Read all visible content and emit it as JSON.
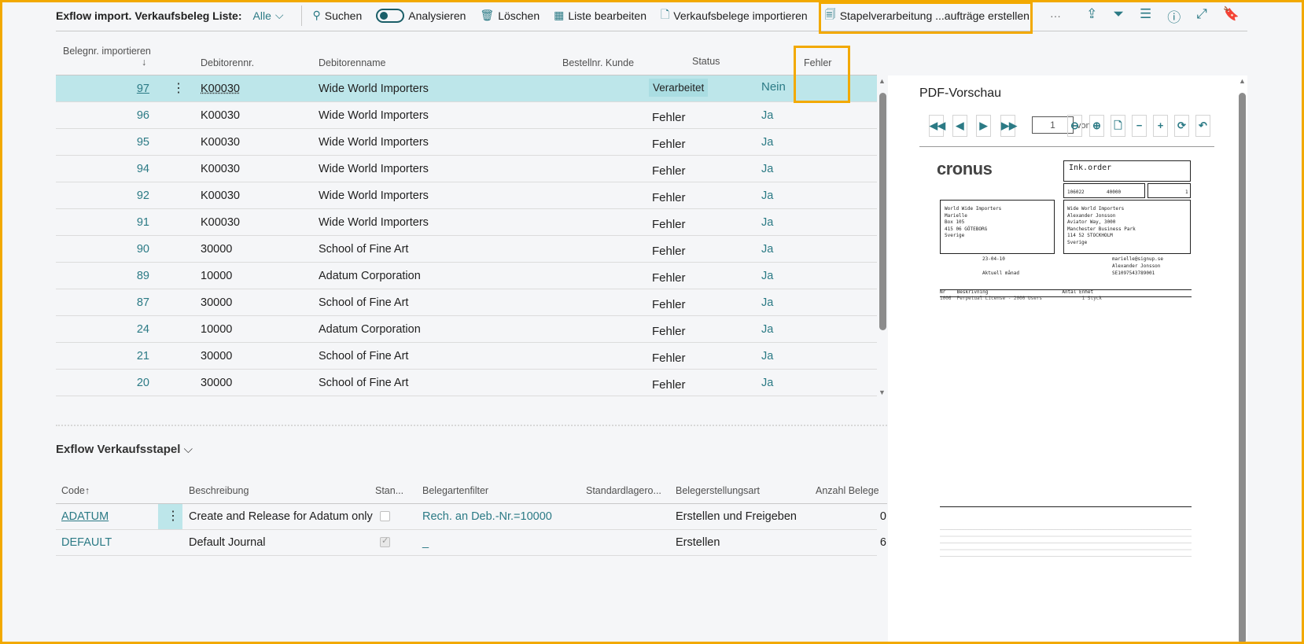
{
  "toolbar": {
    "title": "Exflow import. Verkaufsbeleg Liste:",
    "filter": "Alle",
    "search": "Suchen",
    "analyze": "Analysieren",
    "delete": "Löschen",
    "edit_list": "Liste bearbeiten",
    "import": "Verkaufsbelege importieren",
    "batch": "Stapelverarbeitung ...aufträge erstellen",
    "more": "···"
  },
  "table": {
    "columns": [
      "Belegnr. importieren",
      "Debitorennr.",
      "Debitorenname",
      "Bestellnr. Kunde",
      "Status",
      "Fehler"
    ],
    "sort_icon": "↓",
    "rows": [
      {
        "no": "97",
        "cust": "K00030",
        "name": "Wide World Importers",
        "order": "",
        "status": "Verarbeitet",
        "error": "Nein"
      },
      {
        "no": "96",
        "cust": "K00030",
        "name": "Wide World Importers",
        "order": "",
        "status": "Fehler",
        "error": "Ja"
      },
      {
        "no": "95",
        "cust": "K00030",
        "name": "Wide World Importers",
        "order": "",
        "status": "Fehler",
        "error": "Ja"
      },
      {
        "no": "94",
        "cust": "K00030",
        "name": "Wide World Importers",
        "order": "",
        "status": "Fehler",
        "error": "Ja"
      },
      {
        "no": "92",
        "cust": "K00030",
        "name": "Wide World Importers",
        "order": "",
        "status": "Fehler",
        "error": "Ja"
      },
      {
        "no": "91",
        "cust": "K00030",
        "name": "Wide World Importers",
        "order": "",
        "status": "Fehler",
        "error": "Ja"
      },
      {
        "no": "90",
        "cust": "30000",
        "name": "School of Fine Art",
        "order": "",
        "status": "Fehler",
        "error": "Ja"
      },
      {
        "no": "89",
        "cust": "10000",
        "name": "Adatum Corporation",
        "order": "",
        "status": "Fehler",
        "error": "Ja"
      },
      {
        "no": "87",
        "cust": "30000",
        "name": "School of Fine Art",
        "order": "",
        "status": "Fehler",
        "error": "Ja"
      },
      {
        "no": "24",
        "cust": "10000",
        "name": "Adatum Corporation",
        "order": "",
        "status": "Fehler",
        "error": "Ja"
      },
      {
        "no": "21",
        "cust": "30000",
        "name": "School of Fine Art",
        "order": "",
        "status": "Fehler",
        "error": "Ja"
      },
      {
        "no": "20",
        "cust": "30000",
        "name": "School of Fine Art",
        "order": "",
        "status": "Fehler",
        "error": "Ja"
      }
    ]
  },
  "pdf": {
    "title": "PDF-Vorschau",
    "page": "1",
    "page_label": "von",
    "doc": {
      "logo": "cronus",
      "heading": "Ink.order",
      "no": "106022",
      "supplier_no": "40000",
      "page_no": "1",
      "addr_left": "World Wide Importers\nMarielle\nBox 105\n415 06 GÖTEBORG\nSverige",
      "addr_right": "Wide World Importers\nAlexander Jonsson\nAviator Way, 3000\nManchester Business Park\n114 52 STOCKHOLM\nSverige",
      "order_date": "23-04-10",
      "payment": "Aktuell månad",
      "email": "marielle@signup.se",
      "contact": "Alexander Jonsson",
      "vat": "SE1097543789001",
      "line_header": "Nr    Beskrivning                          Antal Enhet",
      "line": "1006  Perpetual License - 2000 Users              1 Styck"
    }
  },
  "batch": {
    "title": "Exflow Verkaufsstapel",
    "columns": [
      "Code",
      "Beschreibung",
      "Stan...",
      "Belegartenfilter",
      "Standardlagero...",
      "Belegerstellungsart",
      "Anzahl Belege"
    ],
    "sort_icon": "↑",
    "rows": [
      {
        "code": "ADATUM",
        "desc": "Create and Release for Adatum only",
        "std": false,
        "filter": "Rech. an Deb.-Nr.=10000",
        "loc": "",
        "type": "Erstellen und Freigeben",
        "count": "0"
      },
      {
        "code": "DEFAULT",
        "desc": "Default Journal",
        "std": true,
        "filter": "_",
        "loc": "",
        "type": "Erstellen",
        "count": "6"
      }
    ]
  },
  "colors": {
    "accent": "#2b7a85",
    "highlight": "#f2a900",
    "selected_row": "#bde6ea"
  }
}
